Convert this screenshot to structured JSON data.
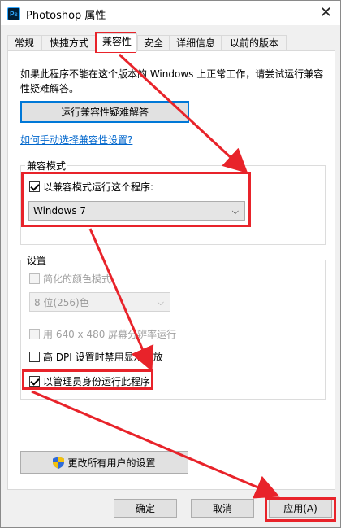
{
  "window": {
    "icon_label": "Ps",
    "title": "Photoshop 属性",
    "close": "✕"
  },
  "tabs": [
    "常规",
    "快捷方式",
    "兼容性",
    "安全",
    "详细信息",
    "以前的版本"
  ],
  "active_tab": "兼容性",
  "info_text": "如果此程序不能在这个版本的 Windows 上正常工作，请尝试运行兼容性疑难解答。",
  "troubleshooter_button": "运行兼容性疑难解答",
  "manual_link": "如何手动选择兼容性设置?",
  "compat_mode": {
    "group_title": "兼容模式",
    "checkbox_label": "以兼容模式运行这个程序:",
    "checked": true,
    "os_select_value": "Windows 7"
  },
  "settings": {
    "group_title": "设置",
    "reduced_color_label": "简化的颜色模式",
    "color_select_value": "8 位(256)色",
    "resolution_label": "用 640 x 480 屏幕分辨率运行",
    "dpi_label": "高 DPI 设置时禁用显示缩放",
    "admin_label": "以管理员身份运行此程序",
    "admin_checked": true
  },
  "all_users_button": "更改所有用户的设置",
  "buttons": {
    "ok": "确定",
    "cancel": "取消",
    "apply": "应用(A)"
  },
  "colors": {
    "annotation_red": "#e8232a",
    "link_blue": "#0066cc",
    "focus_blue": "#0078d7"
  }
}
